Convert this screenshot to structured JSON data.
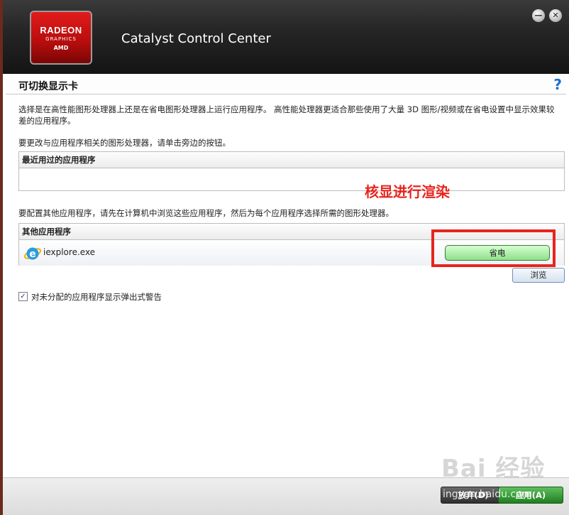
{
  "header": {
    "logo": {
      "line1": "RADEON",
      "line2": "GRAPHICS",
      "line3": "AMD"
    },
    "app_title": "Catalyst Control Center",
    "minimize_glyph": "—",
    "close_glyph": "✕"
  },
  "section": {
    "title": "可切换显示卡",
    "help_glyph": "?"
  },
  "description": "选择是在高性能图形处理器上还是在省电图形处理器上运行应用程序。 高性能处理器更适合那些使用了大量 3D 图形/视频或在省电设置中显示效果较差的应用程序。",
  "hint_recent": "要更改与应用程序相关的图形处理器，请单击旁边的按钮。",
  "recent_apps": {
    "header": "最近用过的应用程序"
  },
  "annotation": "核显进行渲染",
  "hint_other": "要配置其他应用程序，请先在计算机中浏览这些应用程序，然后为每个应用程序选择所需的图形处理器。",
  "other_apps": {
    "header": "其他应用程序",
    "rows": [
      {
        "name": "iexplore.exe",
        "gpu": "省电",
        "icon": "internet-explorer-icon"
      }
    ]
  },
  "browse_label": "浏览",
  "checkbox": {
    "checked": true,
    "label": "对未分配的应用程序显示弹出式警告"
  },
  "footer": {
    "discard_label": "放弃(D)",
    "apply_label": "应用(A)"
  },
  "watermark": {
    "text": "Bai 经验",
    "url": "ingyan.baidu.com"
  },
  "colors": {
    "accent_red": "#e8241d",
    "select_green": "#8fe08a",
    "help_blue": "#1b6fd0"
  }
}
